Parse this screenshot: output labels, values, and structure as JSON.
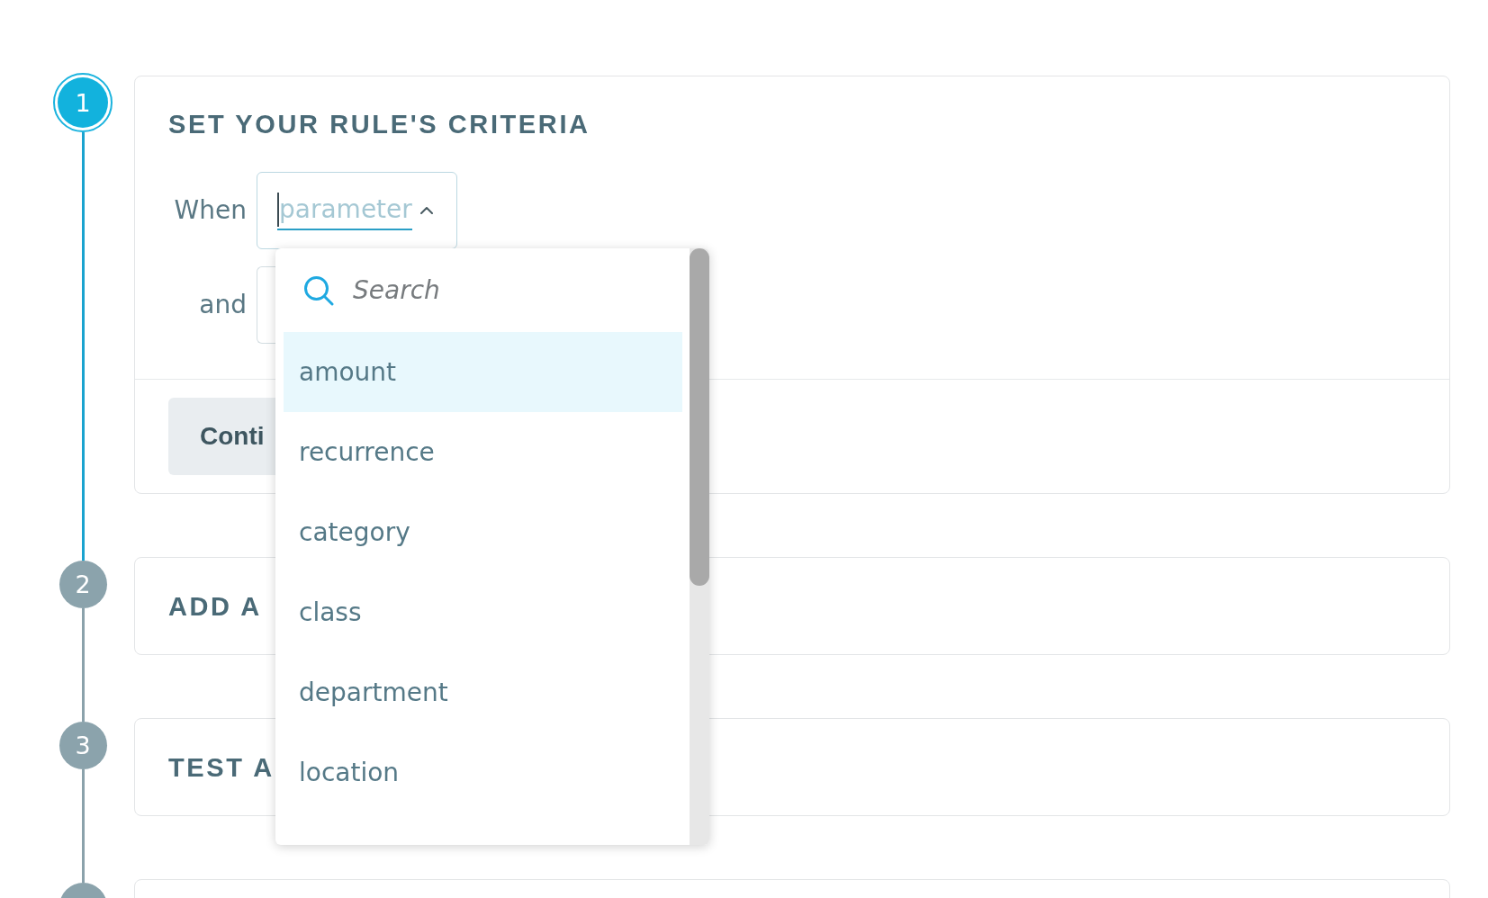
{
  "steps": [
    {
      "number": "1",
      "title": "SET YOUR RULE'S CRITERIA",
      "active": true,
      "criteria": [
        {
          "label": "When",
          "placeholder": "parameter",
          "open": true,
          "dropdown": {
            "search": {
              "placeholder": "Search"
            },
            "options": [
              {
                "label": "amount",
                "selected": true
              },
              {
                "label": "recurrence",
                "selected": false
              },
              {
                "label": "category",
                "selected": false
              },
              {
                "label": "class",
                "selected": false
              },
              {
                "label": "department",
                "selected": false
              },
              {
                "label": "location",
                "selected": false
              }
            ]
          }
        },
        {
          "label": "and"
        }
      ],
      "button": "Conti"
    },
    {
      "number": "2",
      "title": "ADD A",
      "active": false
    },
    {
      "number": "3",
      "title": "TEST A",
      "active": false
    },
    {
      "active": false
    }
  ]
}
